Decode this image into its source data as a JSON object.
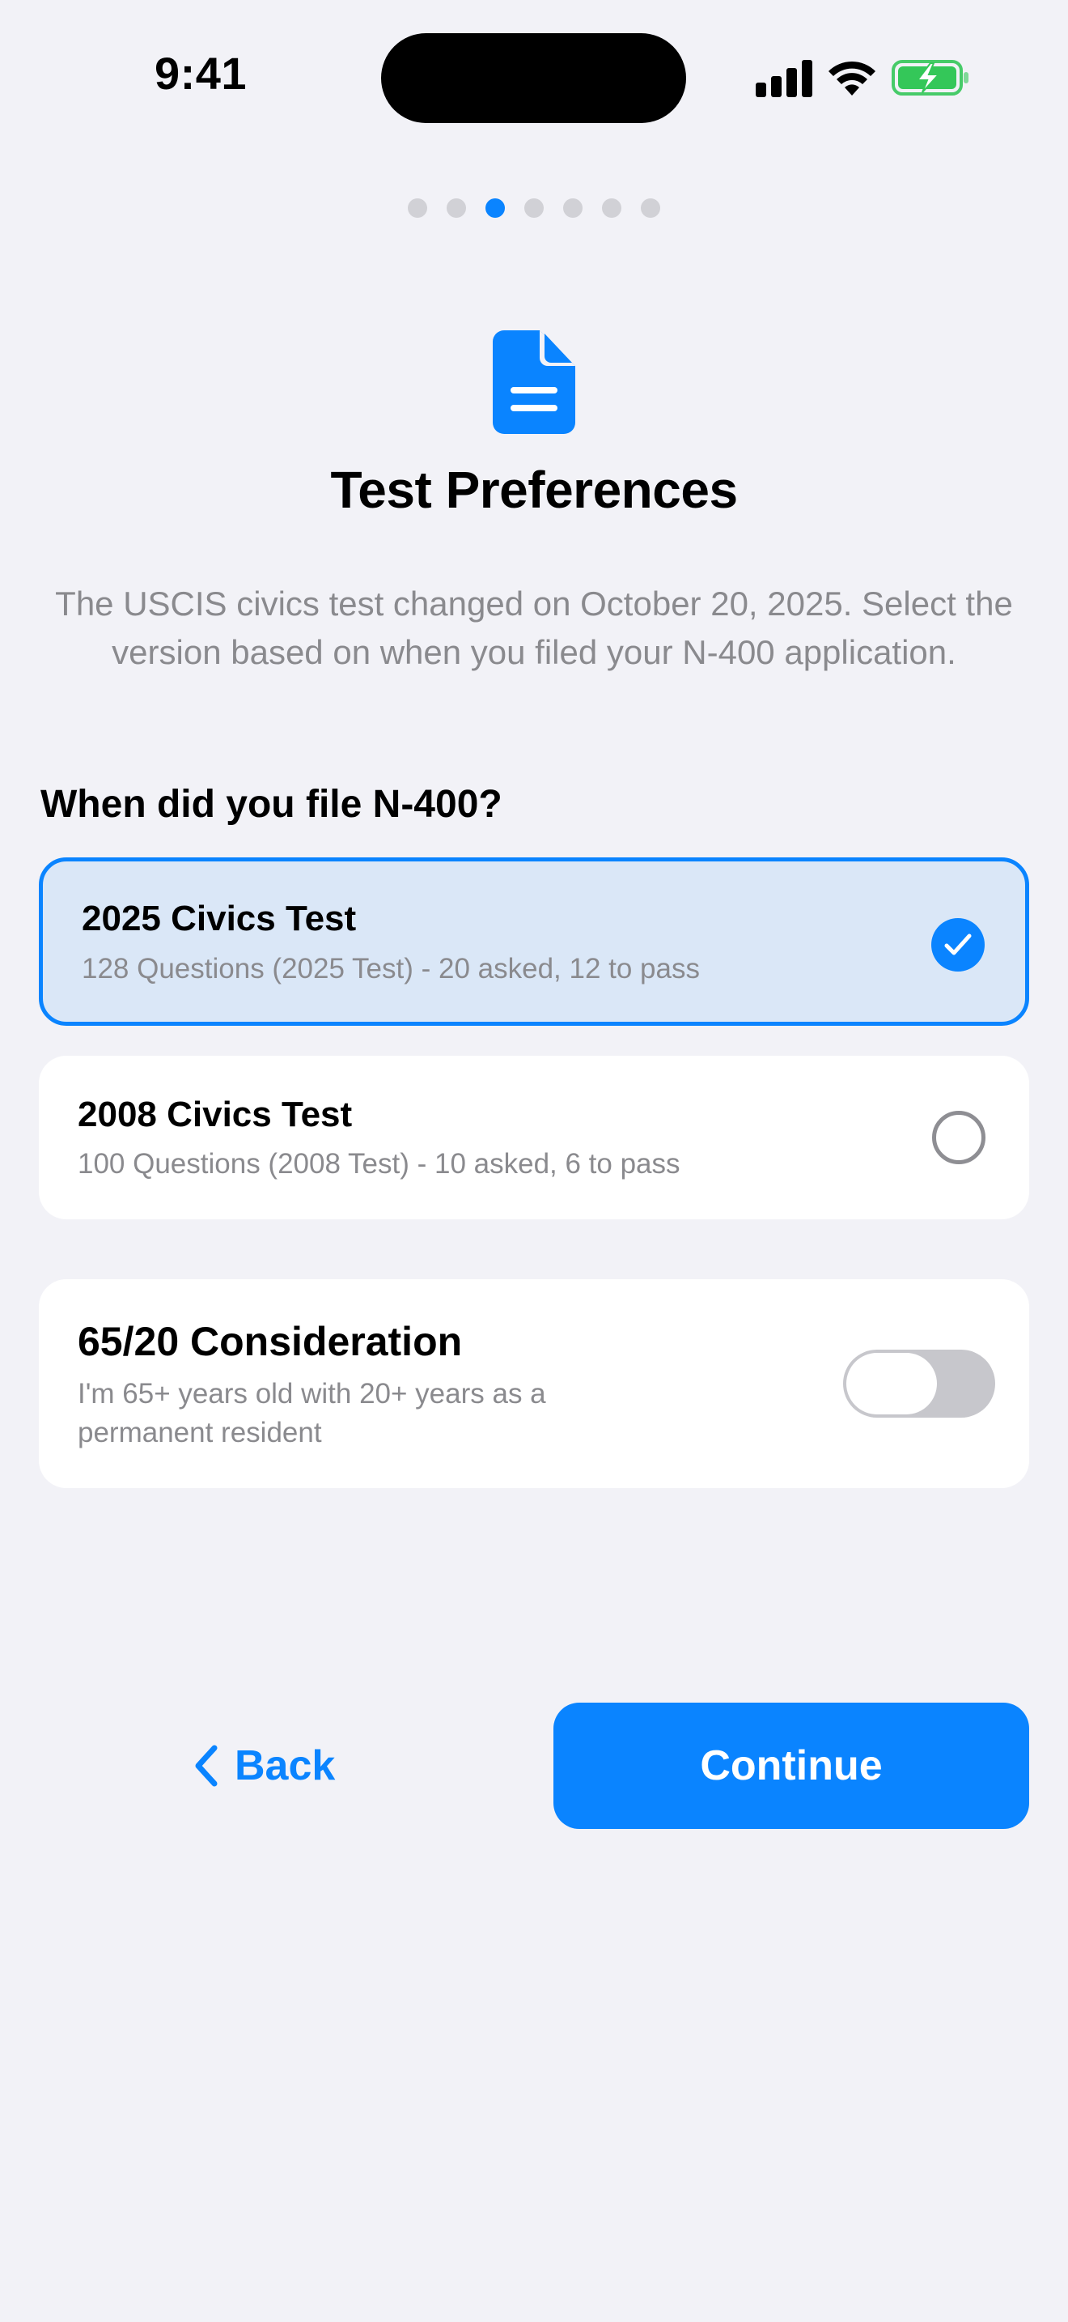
{
  "status_bar": {
    "time": "9:41"
  },
  "pager": {
    "count": 7,
    "active_index": 2
  },
  "header": {
    "icon": "document-icon",
    "title": "Test Preferences",
    "description": "The USCIS civics test changed on October 20, 2025. Select the version based on when you filed your N-400 application."
  },
  "question": "When did you file N-400?",
  "options": [
    {
      "title": "2025 Civics Test",
      "subtitle": "128 Questions (2025 Test) - 20 asked, 12 to pass",
      "selected": true
    },
    {
      "title": "2008 Civics Test",
      "subtitle": "100 Questions (2008 Test) - 10 asked, 6 to pass",
      "selected": false
    }
  ],
  "consideration": {
    "title": "65/20 Consideration",
    "subtitle_line1": "I'm 65+ years old with 20+ years as a",
    "subtitle_line2": "permanent resident",
    "enabled": false
  },
  "buttons": {
    "back": "Back",
    "continue": "Continue"
  },
  "colors": {
    "accent": "#0a84ff",
    "background": "#f2f2f7",
    "selected_card": "#dae7f7",
    "battery_green": "#34c759"
  }
}
